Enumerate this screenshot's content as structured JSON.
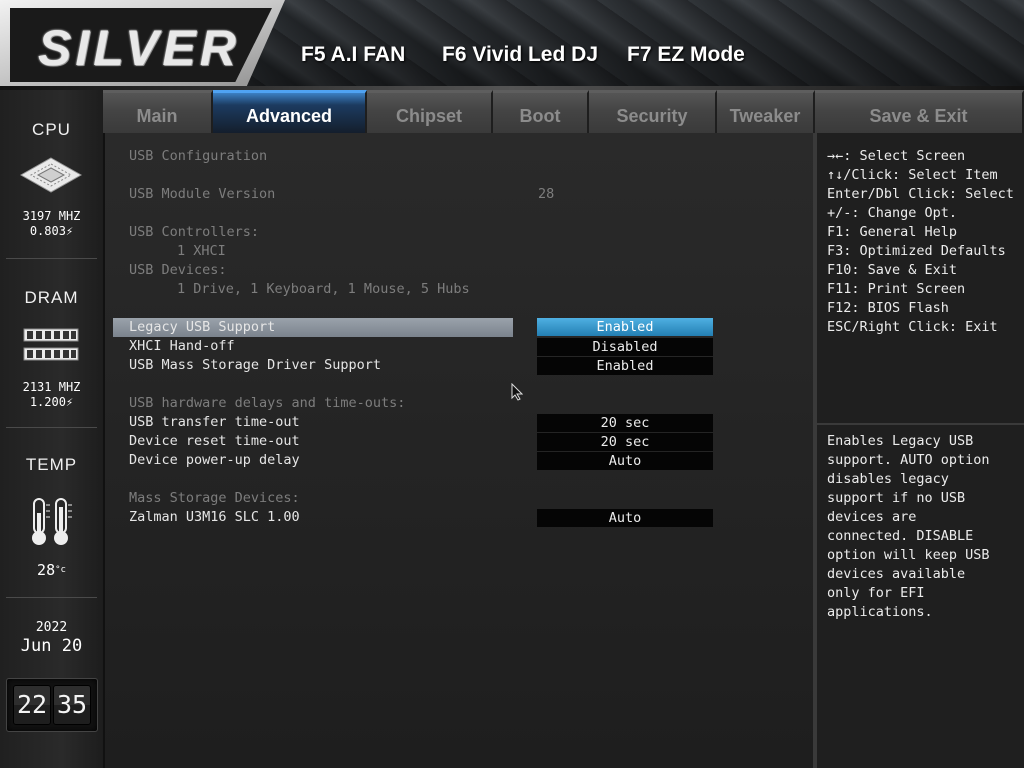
{
  "header": {
    "logo_text": "SILVER",
    "hotkeys": [
      "F5 A.I FAN",
      "F6 Vivid Led DJ",
      "F7 EZ Mode"
    ]
  },
  "sidebar": {
    "cpu": {
      "label": "CPU",
      "freq": "3197 MHZ",
      "volt": "0.803"
    },
    "dram": {
      "label": "DRAM",
      "freq": "2131 MHZ",
      "volt": "1.200"
    },
    "temp": {
      "label": "TEMP",
      "value": "28"
    },
    "date": {
      "year": "2022",
      "month_day": "Jun 20"
    },
    "clock": {
      "hour": "22",
      "minute": "35"
    }
  },
  "tabs": [
    "Main",
    "Advanced",
    "Chipset",
    "Boot",
    "Security",
    "Tweaker",
    "Save & Exit"
  ],
  "active_tab": "Advanced",
  "main": {
    "section_title": "USB Configuration",
    "module_version_label": "USB Module Version",
    "module_version_value": "28",
    "controllers_label": "USB Controllers:",
    "controllers_value": "1 XHCI",
    "devices_label": "USB Devices:",
    "devices_value": "1 Drive, 1 Keyboard, 1 Mouse, 5 Hubs",
    "legacy_label": "Legacy USB Support",
    "legacy_value": "Enabled",
    "xhci_label": "XHCI Hand-off",
    "xhci_value": "Disabled",
    "mass_driver_label": "USB Mass Storage Driver Support",
    "mass_driver_value": "Enabled",
    "delays_header": "USB hardware delays and time-outs:",
    "transfer_label": "USB transfer time-out",
    "transfer_value": "20 sec",
    "reset_label": "Device reset time-out",
    "reset_value": "20 sec",
    "powerup_label": "Device power-up delay",
    "powerup_value": "Auto",
    "mass_devices_header": "Mass Storage Devices:",
    "zalman_label": "Zalman U3M16 SLC 1.00",
    "zalman_value": "Auto"
  },
  "help": {
    "keys": [
      "→←: Select Screen",
      "↑↓/Click: Select Item",
      "Enter/Dbl Click: Select",
      "+/-: Change Opt.",
      "F1: General Help",
      "F3: Optimized Defaults",
      "F10: Save & Exit",
      "F11: Print Screen",
      "F12: BIOS Flash",
      "ESC/Right Click: Exit"
    ],
    "description": [
      "Enables Legacy USB",
      "support. AUTO option",
      "disables legacy",
      "support if no USB",
      "devices are",
      "connected. DISABLE",
      "option will keep USB",
      "devices available",
      "only for EFI",
      "applications."
    ]
  },
  "colors": {
    "accent": "#237fb3",
    "highlight": "#8a929b"
  }
}
